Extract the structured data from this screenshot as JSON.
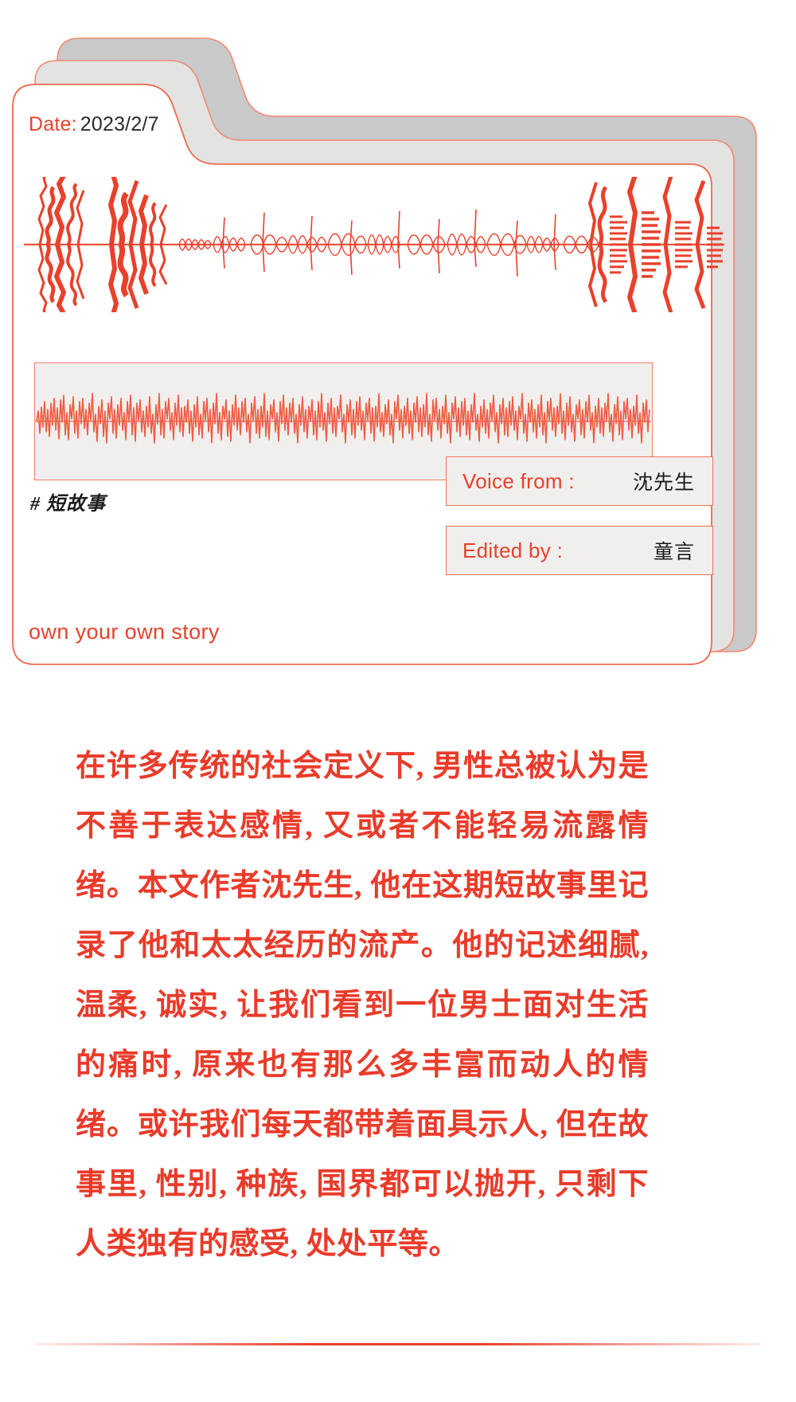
{
  "card": {
    "date_label": "Date:",
    "date_value": "2023/2/7",
    "hashtag": "# 短故事",
    "slogan": "own your own story",
    "voice_from_label": "Voice from :",
    "voice_from_value": "沈先生",
    "edited_by_label": "Edited by :",
    "edited_by_value": "童言"
  },
  "body": {
    "paragraph": "在许多传统的社会定义下, 男性总被认为是不善于表达感情, 又或者不能轻易流露情绪。本文作者沈先生, 他在这期短故事里记录了他和太太经历的流产。他的记述细腻, 温柔, 诚实, 让我们看到一位男士面对生活的痛时, 原来也有那么多丰富而动人的情绪。或许我们每天都带着面具示人, 但在故事里, 性别, 种族, 国界都可以抛开, 只剩下人类独有的感受, 处处平等。"
  },
  "colors": {
    "accent_red": "#e8412c",
    "body_red": "#ea3b2a",
    "border_salmon": "#ee7153",
    "panel_gray": "#f0efed",
    "card_back_dark": "#c9c9c9",
    "card_back_light": "#e3e3e1"
  },
  "icons": {
    "waveform_big": "audio-waveform-icon",
    "waveform_line": "audio-line-waveform-icon"
  }
}
